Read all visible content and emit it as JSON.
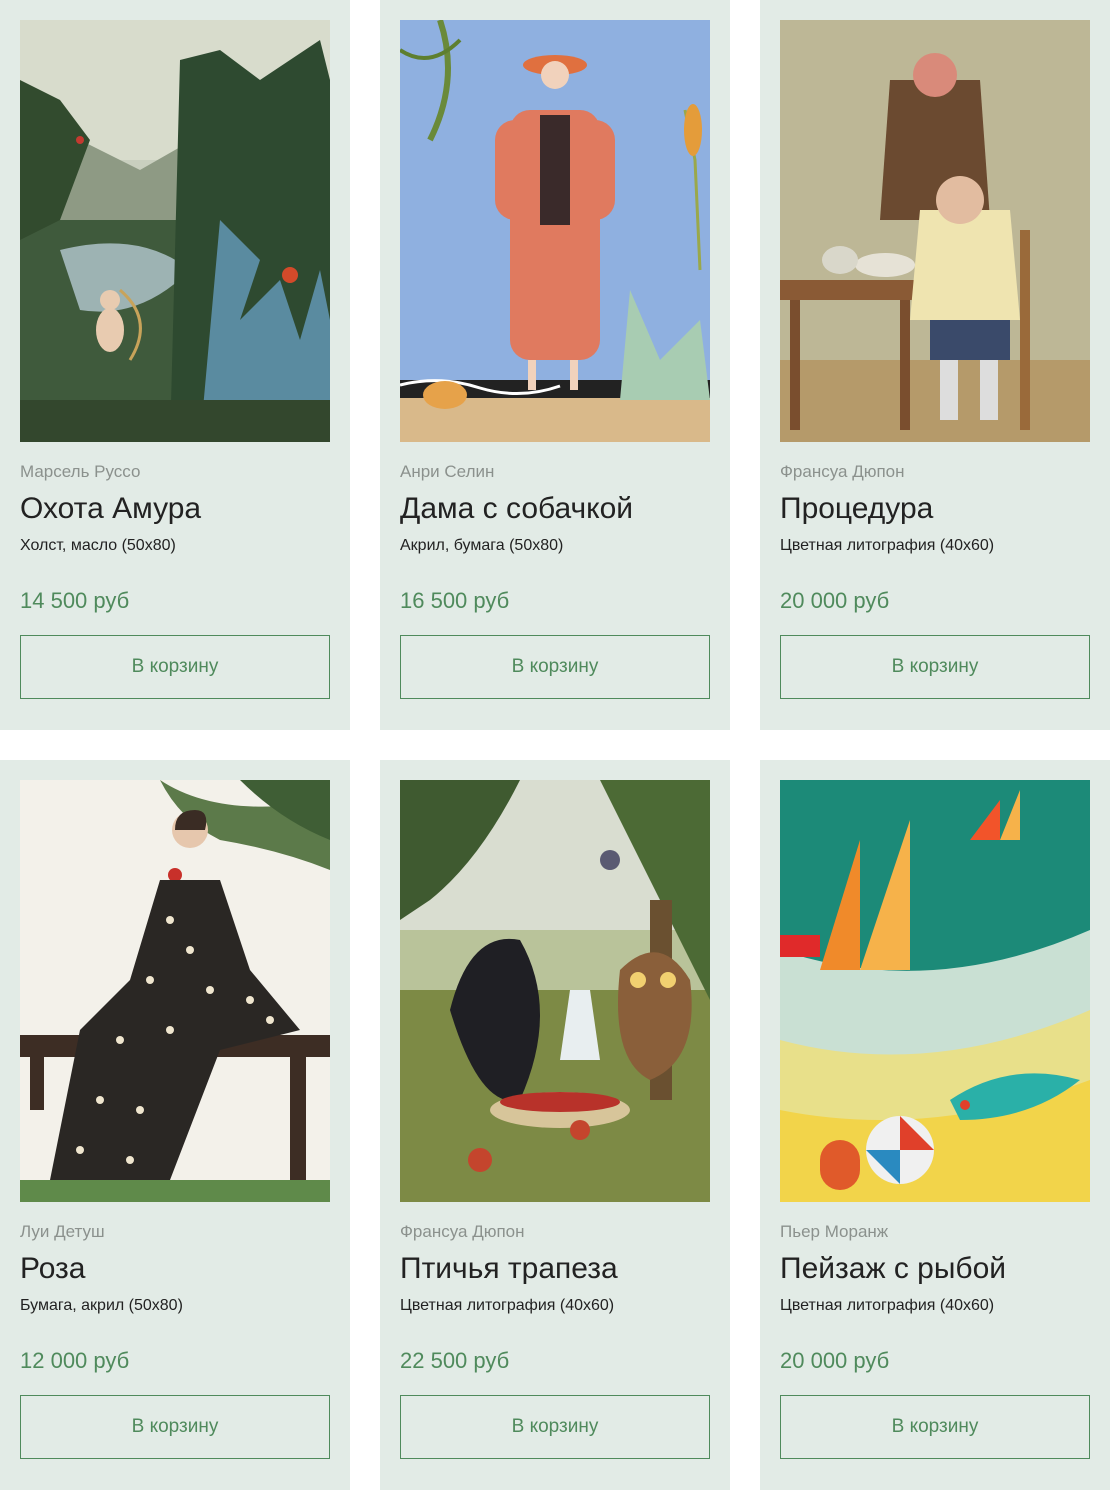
{
  "products": [
    {
      "author": "Марсель Руссо",
      "title": "Охота Амура",
      "medium": "Холст, масло (50х80)",
      "price": "14 500 руб",
      "button": "В корзину",
      "image": "tropical-landscape-cupid-painting"
    },
    {
      "author": "Анри Селин",
      "title": "Дама с собачкой",
      "medium": "Акрил, бумага (50х80)",
      "price": "16 500 руб",
      "button": "В корзину",
      "image": "lady-in-coral-coat-with-dog"
    },
    {
      "author": "Франсуа Дюпон",
      "title": "Процедура",
      "medium": "Цветная литография (40х60)",
      "price": "20 000 руб",
      "button": "В корзину",
      "image": "barber-procedure-lithograph"
    },
    {
      "author": "Луи Детуш",
      "title": "Роза",
      "medium": "Бумага, акрил (50х80)",
      "price": "12 000 руб",
      "button": "В корзину",
      "image": "woman-in-polka-dot-dress-with-rose"
    },
    {
      "author": "Франсуа Дюпон",
      "title": "Птичья трапеза",
      "medium": "Цветная литография (40х60)",
      "price": "22 500 руб",
      "button": "В корзину",
      "image": "birds-feast-lithograph"
    },
    {
      "author": "Пьер Моранж",
      "title": "Пейзаж с рыбой",
      "medium": "Цветная литография (40х60)",
      "price": "20 000 руб",
      "button": "В корзину",
      "image": "abstract-sails-and-fish-poster"
    }
  ],
  "colors": {
    "card_bg": "#e2ebe6",
    "accent": "#4f8a5c",
    "author_gray": "#8b918d",
    "text": "#222222"
  }
}
